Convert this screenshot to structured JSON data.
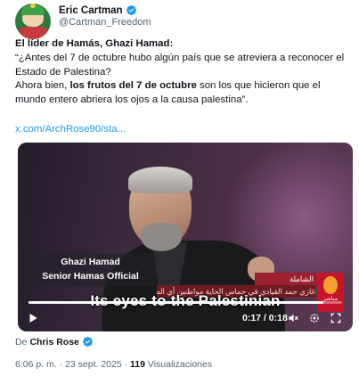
{
  "author": {
    "name": "Eric Cartman",
    "handle": "@Cartman_Freedom",
    "verified": true
  },
  "tweet": {
    "line1": "El líder de Hamás, Ghazi Hamad:",
    "line2": "“¿Antes del 7 de octubre hubo algún país que se atreviera a reconocer el",
    "line3": "Estado de Palestina?",
    "line4_pre": "Ahora bien, ",
    "line4_bold": "los frutos del 7 de octubre",
    "line4_post": " son los que hicieron que el",
    "line5": "mundo entero abriera los ojos a la causa palestina”.",
    "link": "x.com/ArchRose90/sta..."
  },
  "video": {
    "caption_name": "Ghazi Hamad",
    "caption_role": "Senior Hamas Official",
    "subtitle": "Its eyes to the Palestinian",
    "ticker_main": "غازي حمد القيادي في حماس الحاية مواطنين أي الصفقة",
    "ticker_side": "الشاملة",
    "logo_text": "مباشر",
    "current_time": "0:17",
    "duration": "0:18",
    "time_display": "0:17 / 0:18",
    "progress": 0.94,
    "icons": [
      "play-icon",
      "volume-icon",
      "settings-icon",
      "fullscreen-icon"
    ]
  },
  "source": {
    "prefix": "De",
    "name": "Chris Rose",
    "verified": true
  },
  "meta": {
    "time": "6:06 p. m.",
    "separator": "·",
    "date": "23 sept. 2025",
    "views_count": "119",
    "views_label": "Visualizaciones"
  },
  "colors": {
    "accent": "#1d9bf0",
    "secondary_text": "#536471",
    "primary_text": "#0f1419"
  }
}
